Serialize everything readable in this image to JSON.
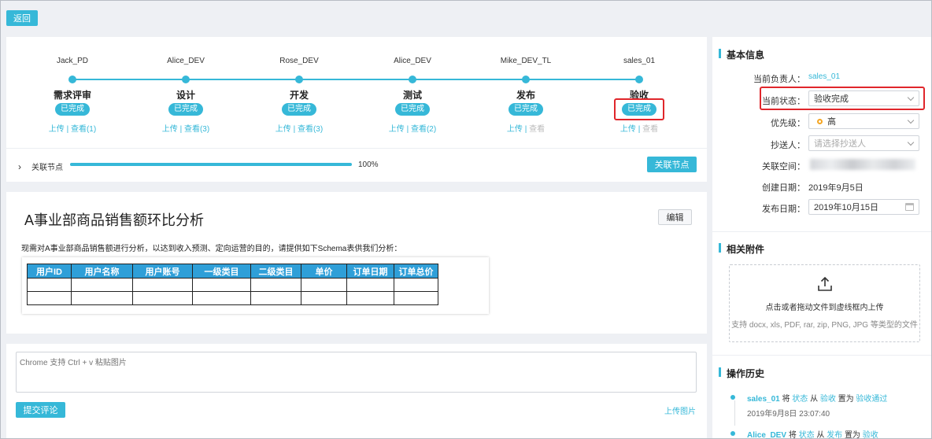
{
  "back_label": "返回",
  "steps": [
    {
      "owner": "Jack_PD",
      "name": "需求评审",
      "status": "已完成",
      "upload": "上传",
      "sep": "|",
      "view": "查看(1)"
    },
    {
      "owner": "Alice_DEV",
      "name": "设计",
      "status": "已完成",
      "upload": "上传",
      "sep": "|",
      "view": "查看(3)"
    },
    {
      "owner": "Rose_DEV",
      "name": "开发",
      "status": "已完成",
      "upload": "上传",
      "sep": "|",
      "view": "查看(3)"
    },
    {
      "owner": "Alice_DEV",
      "name": "测试",
      "status": "已完成",
      "upload": "上传",
      "sep": "|",
      "view": "查看(2)"
    },
    {
      "owner": "Mike_DEV_TL",
      "name": "发布",
      "status": "已完成",
      "upload": "上传",
      "sep": "|",
      "view": "查看"
    },
    {
      "owner": "sales_01",
      "name": "验收",
      "status": "已完成",
      "upload": "上传",
      "sep": "|",
      "view": "查看"
    }
  ],
  "related": {
    "label": "关联节点",
    "progress_text": "100%",
    "progress": 1.0,
    "button": "关联节点"
  },
  "doc": {
    "title": "A事业部商品销售额环比分析",
    "edit": "编辑",
    "desc": "现需对A事业部商品销售额进行分析，以达到收入预测、定向运营的目的，请提供如下Schema表供我们分析：",
    "columns": [
      "用户ID",
      "用户名称",
      "用户账号",
      "一级类目",
      "二级类目",
      "单价",
      "订单日期",
      "订单总价"
    ]
  },
  "comment": {
    "placeholder": "Chrome 支持 Ctrl + v 粘贴图片",
    "submit": "提交评论",
    "upload_image": "上传图片"
  },
  "basic": {
    "title": "基本信息",
    "owner_label": "当前负责人：",
    "owner": "sales_01",
    "status_label": "当前状态：",
    "status": "验收完成",
    "priority_label": "优先级：",
    "priority": "高",
    "cc_label": "抄送人：",
    "cc_placeholder": "请选择抄送人",
    "space_label": "关联空间：",
    "created_label": "创建日期：",
    "created": "2019年9月5日",
    "publish_label": "发布日期：",
    "publish": "2019年10月15日"
  },
  "attach": {
    "title": "相关附件",
    "hint": "点击或者拖动文件到虚线框内上传",
    "types": "支持 docx, xls, PDF, rar, zip, PNG, JPG 等类型的文件"
  },
  "history": {
    "title": "操作历史",
    "items": [
      {
        "user": "sales_01",
        "w1": "将",
        "field": "状态",
        "w2": "从",
        "from": "验收",
        "w3": "置为",
        "to": "验收通过",
        "time": "2019年9月8日 23:07:40"
      },
      {
        "user": "Alice_DEV",
        "w1": "将",
        "field": "状态",
        "w2": "从",
        "from": "发布",
        "w3": "置为",
        "to": "验收"
      }
    ]
  },
  "colors": {
    "accent": "#36b8d8",
    "highlight": "#e0262b",
    "priority_dot": "#f5a623"
  }
}
